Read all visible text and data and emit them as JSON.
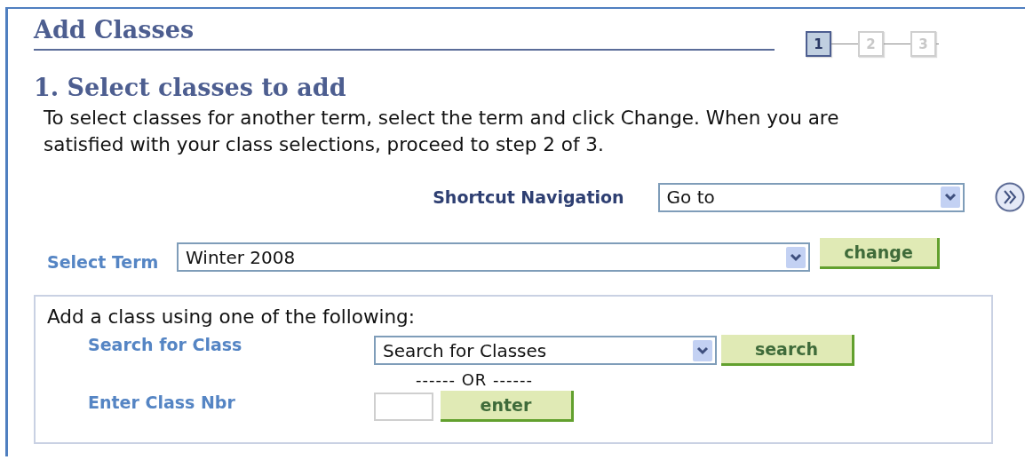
{
  "title": "Add Classes",
  "steps": [
    {
      "label": "1",
      "selected": true
    },
    {
      "label": "2",
      "selected": false
    },
    {
      "label": "3",
      "selected": false
    }
  ],
  "heading": "1. Select classes to add",
  "instructions": "To select classes for another term, select the term and click Change. When you are satisfied with your class selections, proceed to step 2 of 3.",
  "shortcut": {
    "label": "Shortcut Navigation",
    "value": "Go to"
  },
  "term": {
    "label": "Select Term",
    "value": "Winter 2008",
    "button": "change"
  },
  "add_panel": {
    "intro": "Add a class using one of the following:",
    "search": {
      "label": "Search for Class",
      "value": "Search for Classes",
      "button": "search"
    },
    "separator": "------ OR ------",
    "class_nbr": {
      "label": "Enter Class Nbr",
      "button": "enter"
    }
  }
}
